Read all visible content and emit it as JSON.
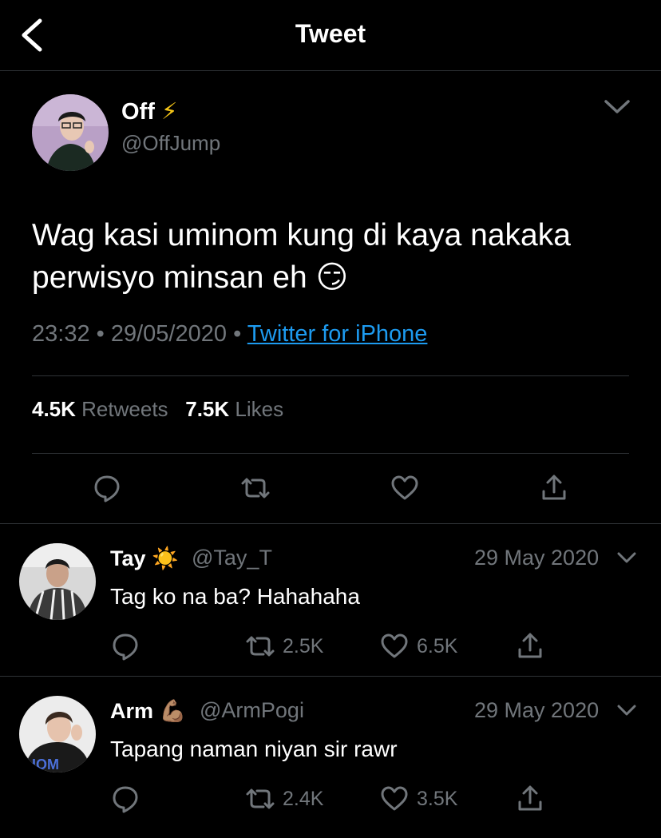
{
  "header": {
    "title": "Tweet"
  },
  "tweet": {
    "author_name": "Off",
    "author_emoji": "⚡",
    "author_handle": "@OffJump",
    "text_line1": "Wag kasi uminom kung di kaya nakaka",
    "text_line2": "perwisyo minsan eh",
    "text_emoji": "😏",
    "time": "23:32",
    "date": "29/05/2020",
    "source": "Twitter for iPhone",
    "retweets_count": "4.5K",
    "retweets_label": "Retweets",
    "likes_count": "7.5K",
    "likes_label": "Likes"
  },
  "replies": [
    {
      "name": "Tay",
      "emoji": "☀️",
      "handle": "@Tay_T",
      "date": "29 May 2020",
      "text": "Tag ko na ba? Hahahaha",
      "retweets": "2.5K",
      "likes": "6.5K"
    },
    {
      "name": "Arm",
      "emoji": "💪🏽",
      "handle": "@ArmPogi",
      "date": "29 May 2020",
      "text": "Tapang naman niyan sir rawr",
      "retweets": "2.4K",
      "likes": "3.5K",
      "avatar_shirt_text": "HOM"
    }
  ],
  "colors": {
    "accent": "#1d9bf0",
    "muted": "#71767b",
    "divider": "#2f3336"
  }
}
